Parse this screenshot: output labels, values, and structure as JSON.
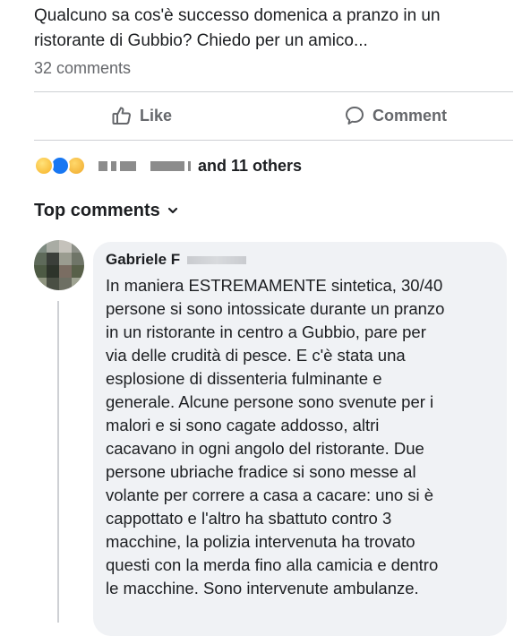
{
  "post": {
    "text_line1": "Qualcuno sa cos'è successo domenica a pranzo in un",
    "text_line2": "ristorante di Gubbio? Chiedo per un amico...",
    "comment_count": "32 comments"
  },
  "actions": {
    "like_label": "Like",
    "like_icon": "thumbs-up-icon",
    "comment_label": "Comment",
    "comment_icon": "speech-bubble-icon"
  },
  "reactions": {
    "icons": [
      "haha-emoji",
      "like-emoji",
      "care-emoji"
    ],
    "others_text": "and 11 others"
  },
  "comments_section": {
    "header": "Top comments",
    "chevron_icon": "chevron-down-icon"
  },
  "comment": {
    "author": "Gabriele F",
    "lines": [
      "In maniera ESTREMAMENTE sintetica, 30/40",
      "persone si sono intossicate durante un pranzo",
      "in un ristorante in centro a Gubbio, pare per",
      "via delle crudità di pesce. E c'è stata una",
      "esplosione di dissenteria fulminante e",
      "generale. Alcune persone sono svenute per i",
      "malori e si sono cagate addosso, altri",
      "cacavano in ogni angolo del ristorante. Due",
      "persone ubriache fradice si sono messe al",
      "volante per correre a casa a cacare: uno si è",
      "cappottato e l'altro ha sbattuto contro 3",
      "macchine, la polizia intervenuta ha trovato",
      "questi con la merda fino alla camicia e dentro",
      "le macchine. Sono intervenute ambulanze."
    ]
  },
  "colors": {
    "text_primary": "#1c1e21",
    "text_secondary": "#65676b",
    "bubble_bg": "#f0f2f5",
    "divider": "#ced0d4"
  }
}
